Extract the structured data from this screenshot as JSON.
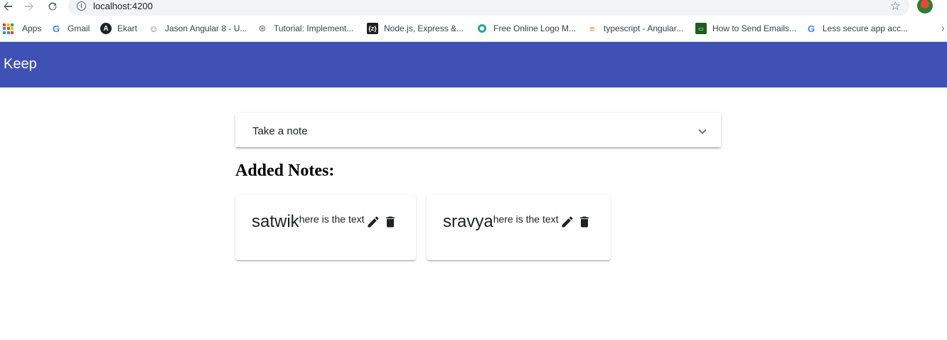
{
  "browser": {
    "url": "localhost:4200",
    "bookmarks": [
      {
        "label": "Apps",
        "icon": "apps-grid-icon"
      },
      {
        "label": "Gmail",
        "icon": "google-icon",
        "color": "#4285f4"
      },
      {
        "label": "Ekart",
        "icon": "angular-icon",
        "color": "#202124"
      },
      {
        "label": "Jason Angular 8 - U...",
        "icon": "avatar-icon",
        "color": "#9e9e9e"
      },
      {
        "label": "Tutorial: Implement...",
        "icon": "globe-icon",
        "color": "#8c8c8c"
      },
      {
        "label": "Node.js, Express &...",
        "icon": "zeit-icon",
        "color": "#202124"
      },
      {
        "label": "Free Online Logo M...",
        "icon": "ring-logo-icon",
        "color": "#26a69a"
      },
      {
        "label": "typescript - Angular...",
        "icon": "stackoverflow-icon",
        "color": "#f48024"
      },
      {
        "label": "How to Send Emails...",
        "icon": "monitor-icon",
        "color": "#1b5e20"
      },
      {
        "label": "Less secure app acc...",
        "icon": "google-icon",
        "color": "#4285f4"
      }
    ],
    "more_label": "›"
  },
  "app": {
    "title": "Keep",
    "accent_color": "#3f51b5"
  },
  "panel": {
    "title": "Take a note"
  },
  "notes_heading": "Added Notes:",
  "notes": [
    {
      "title": "satwik",
      "text": "here is the text"
    },
    {
      "title": "sravya",
      "text": "here is the text"
    }
  ]
}
